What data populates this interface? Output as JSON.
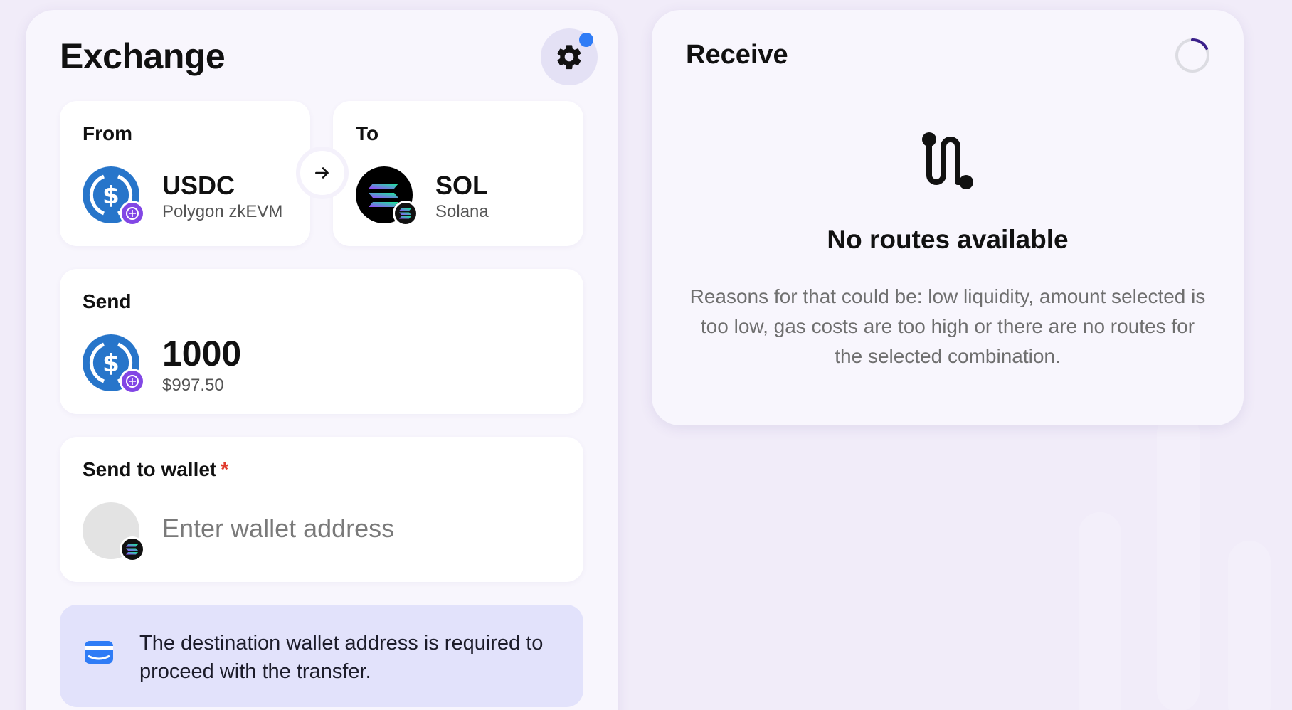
{
  "exchange": {
    "title": "Exchange",
    "settings_icon": "gear-icon",
    "notification_color": "#2f7cf6"
  },
  "from": {
    "label": "From",
    "token": "USDC",
    "chain": "Polygon zkEVM",
    "token_icon": "usdc-icon",
    "chain_icon": "polygon-zkevm-icon"
  },
  "swap": {
    "icon": "arrow-right-icon"
  },
  "to": {
    "label": "To",
    "token": "SOL",
    "chain": "Solana",
    "token_icon": "sol-icon",
    "chain_icon": "solana-icon"
  },
  "send": {
    "label": "Send",
    "amount": "1000",
    "usd_value": "$997.50"
  },
  "wallet": {
    "label": "Send to wallet",
    "required_mark": "*",
    "placeholder": "Enter wallet address",
    "value": ""
  },
  "info": {
    "text": "The destination wallet address is required to proceed with the transfer.",
    "icon": "wallet-icon"
  },
  "receive": {
    "title": "Receive",
    "empty_title": "No routes available",
    "empty_description": "Reasons for that could be: low liquidity, amount selected is too low, gas costs are too high or there are no routes for the selected combination.",
    "empty_icon": "route-icon"
  },
  "colors": {
    "usdc_blue": "#2775ca",
    "polygon_purple": "#8247e5",
    "accent_blue": "#2f7cf6",
    "info_bg": "#e2e2fb"
  }
}
